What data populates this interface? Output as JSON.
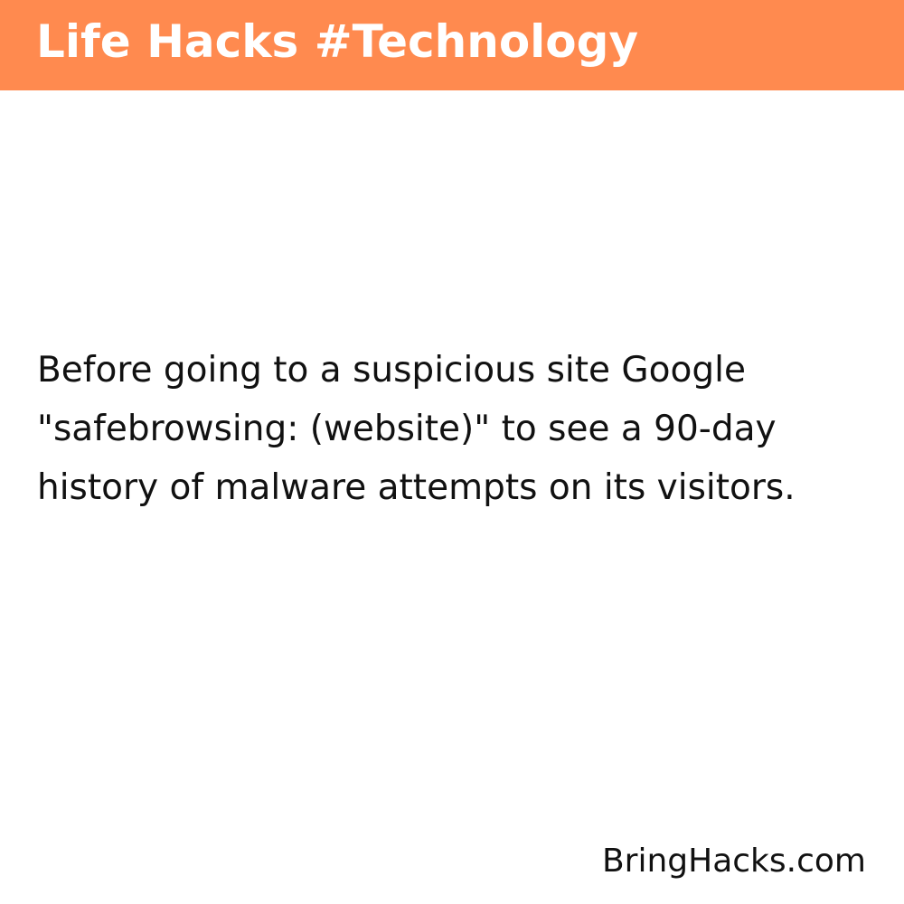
{
  "header": {
    "title": "Life Hacks #Technology",
    "background_color": "#FF8A4F",
    "text_color": "#FFFFFF"
  },
  "main": {
    "text": "Before going to a suspicious site Google \"safebrowsing: (website)\" to see a 90-day history of malware attempts on its visitors.",
    "text_color": "#111111"
  },
  "footer": {
    "brand": "BringHacks.com"
  },
  "page": {
    "background_color": "#FFFFFF"
  }
}
